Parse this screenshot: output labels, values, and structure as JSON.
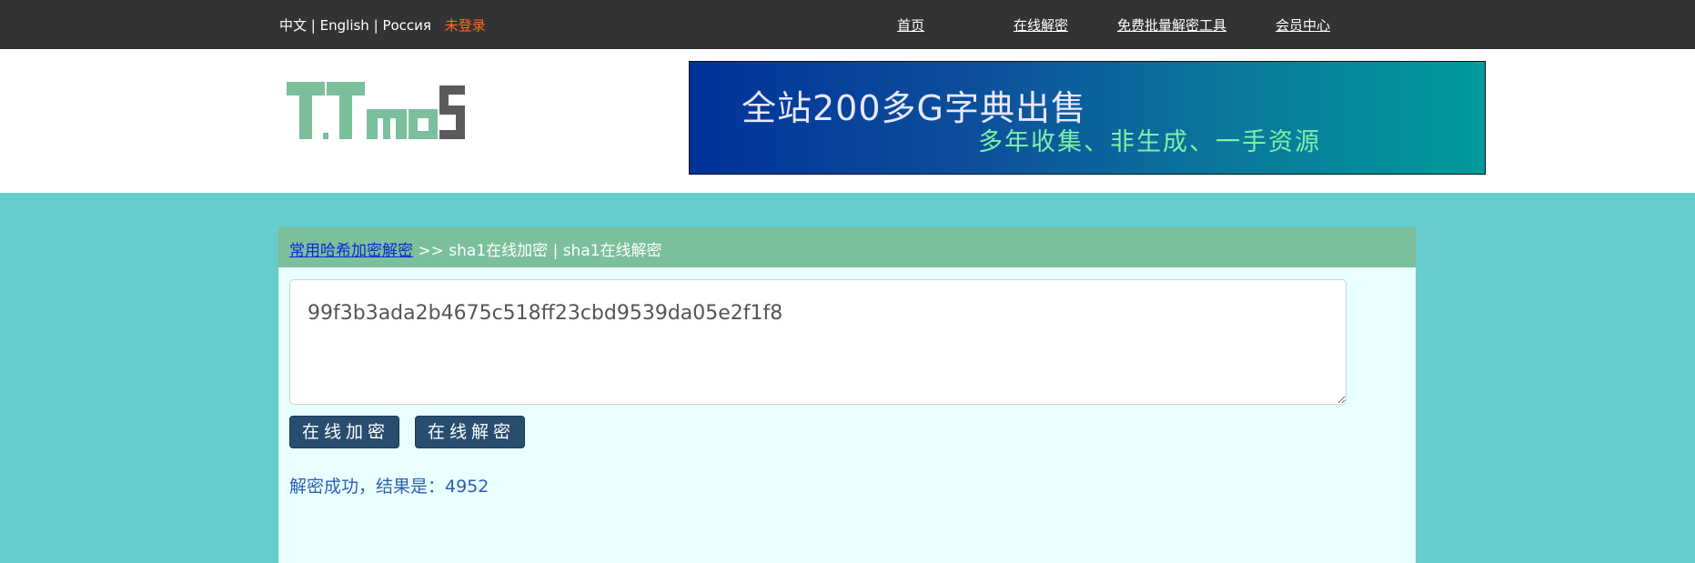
{
  "topbar": {
    "langs": [
      "中文",
      "English",
      "Россия"
    ],
    "separator": "|",
    "login": "未登录",
    "nav": [
      "首页",
      "在线解密",
      "免费批量解密工具",
      "会员中心"
    ]
  },
  "banner": {
    "line1": "全站200多G字典出售",
    "line2": "多年收集、非生成、一手资源"
  },
  "breadcrumb": {
    "link": "常用哈希加密解密",
    "rest": " >> sha1在线加密 | sha1在线解密"
  },
  "input": {
    "value": "99f3b3ada2b4675c518ff23cbd9539da05e2f1f8"
  },
  "buttons": {
    "encrypt": "在线加密",
    "decrypt": "在线解密"
  },
  "result": {
    "text": "解密成功，结果是：4952"
  },
  "colors": {
    "topbar": "#333333",
    "page_bg": "#66cccc",
    "crumb_bar": "#7bbf9b",
    "panel_bg": "#eaffff",
    "button": "#274e6e",
    "login": "#ff6a1a",
    "result": "#2a5fb0",
    "logo_green": "#7bbf9b",
    "logo_gray": "#5a5a5a"
  }
}
